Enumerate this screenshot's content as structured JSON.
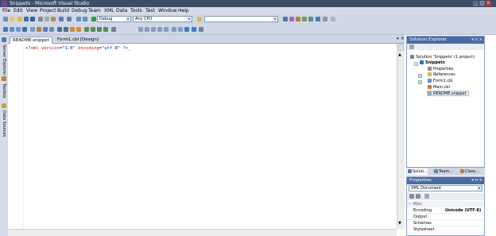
{
  "window": {
    "title": "Snippets - Microsoft Visual Studio"
  },
  "menu": [
    "File",
    "Edit",
    "View",
    "Project",
    "Build",
    "Debug",
    "Team",
    "XML",
    "Data",
    "Tools",
    "Test",
    "Window",
    "Help"
  ],
  "toolbar": {
    "config": "Debug",
    "platform": "Any CPU",
    "find": ""
  },
  "left_strip": {
    "items": [
      "Server Explorer",
      "Toolbox",
      "Data Sources"
    ]
  },
  "tabs": [
    {
      "label": "README.snippet",
      "active": true
    },
    {
      "label": "Form1.cbl [Design]",
      "active": false
    }
  ],
  "editor": {
    "code": {
      "open": "<?",
      "name": "xml",
      "attr1": "version",
      "eq1": "=",
      "val1": "\"1.0\"",
      "attr2": "encoding",
      "eq2": "=",
      "val2": "\"utf-8\"",
      "close": " ?>",
      "cursor": "_"
    }
  },
  "solution_explorer": {
    "title": "Solution Explorer",
    "items": [
      {
        "label": "Solution 'Snippets' (1 project)",
        "icon": "solution-icon",
        "depth": 0,
        "bold": false
      },
      {
        "label": "Snippets",
        "icon": "project-icon",
        "depth": 1,
        "bold": true
      },
      {
        "label": "Properties",
        "icon": "properties-folder-icon",
        "depth": 2,
        "bold": false
      },
      {
        "label": "References",
        "icon": "references-folder-icon",
        "depth": 2,
        "bold": false
      },
      {
        "label": "Form1.cbl",
        "icon": "form-icon",
        "depth": 2,
        "bold": false
      },
      {
        "label": "Main.cbl",
        "icon": "code-file-icon",
        "depth": 2,
        "bold": false
      },
      {
        "label": "README.snippet",
        "icon": "snippet-file-icon",
        "depth": 2,
        "bold": false,
        "selected": true
      }
    ],
    "tabs": [
      "Soluti...",
      "Team...",
      "Class..."
    ]
  },
  "properties": {
    "title": "Properties",
    "object": "XML Document",
    "section": "Misc",
    "rows": [
      {
        "name": "Encoding",
        "value": "Unicode (UTF-8)"
      },
      {
        "name": "Output",
        "value": ""
      },
      {
        "name": "Schemas",
        "value": ""
      },
      {
        "name": "Stylesheet",
        "value": ""
      }
    ]
  },
  "colors": {
    "titlebar": "#3d4d68",
    "panel_header": "#4a6aa3",
    "xml_bracket": "#0000ff",
    "xml_name": "#a31515",
    "xml_attr": "#ff0000"
  }
}
